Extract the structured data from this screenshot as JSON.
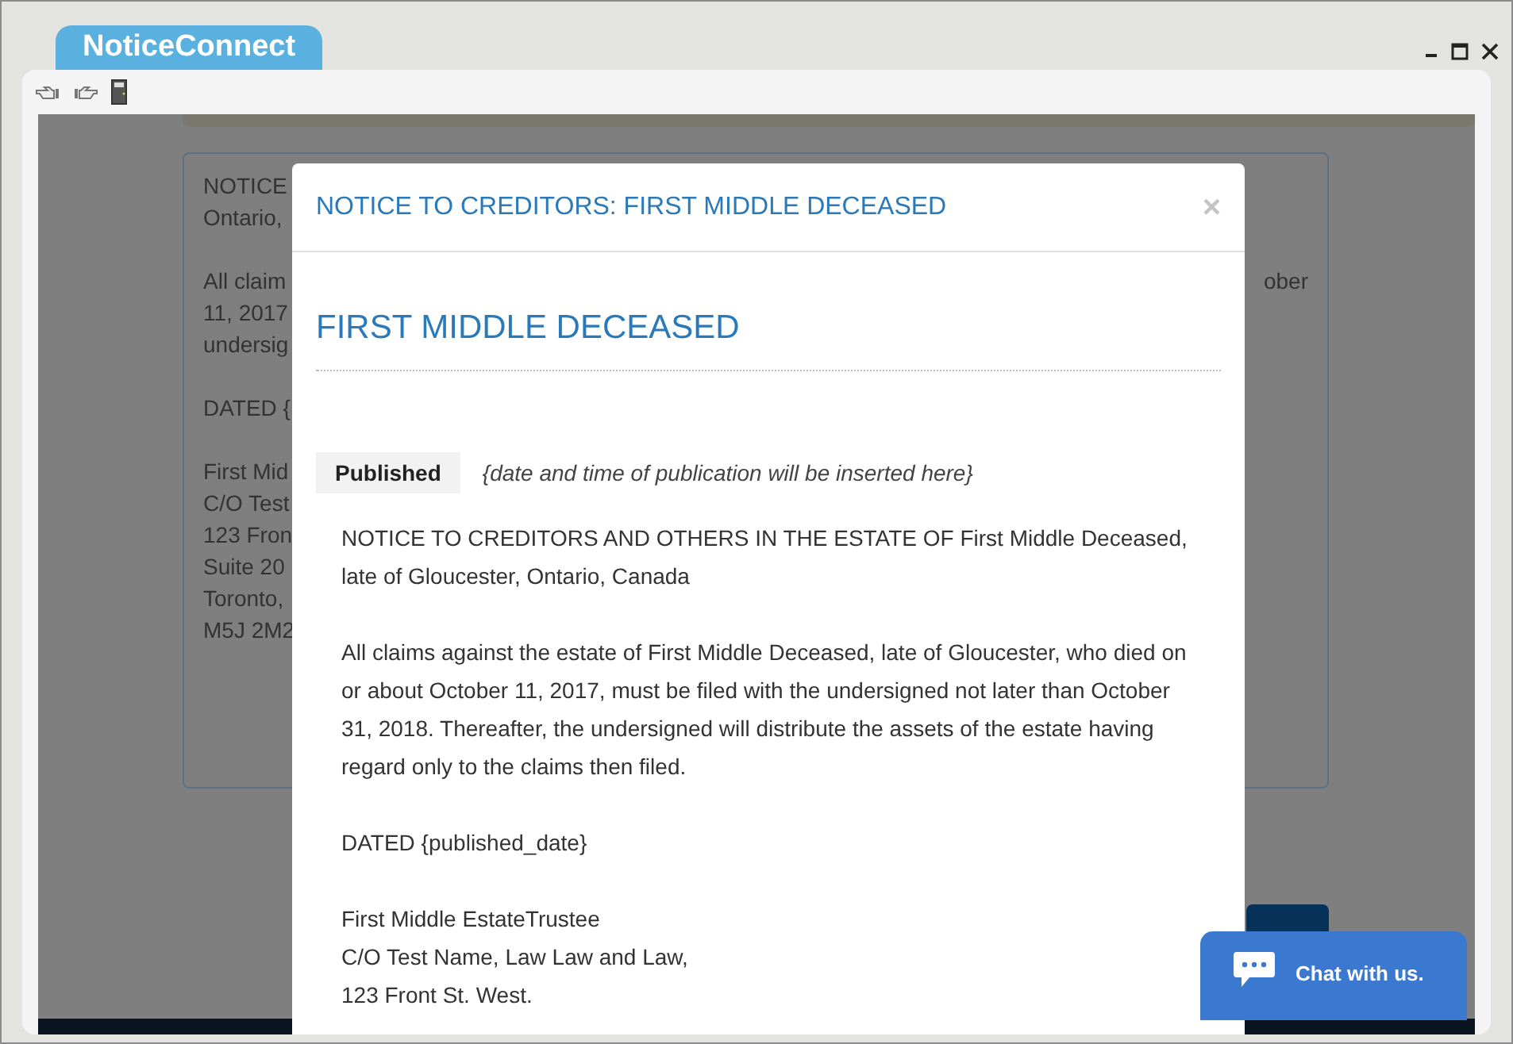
{
  "window": {
    "title": "NoticeConnect"
  },
  "background_notice": {
    "paragraphs": [
      [
        "NOTICE",
        "Ontario,"
      ],
      [
        "All claim",
        "11, 2017",
        "undersig"
      ],
      [
        "DATED {"
      ],
      [
        "First Mid",
        "C/O Test",
        "123 Fron",
        "Suite 20",
        "Toronto,",
        "M5J 2M2"
      ]
    ],
    "right_fragment": "ober"
  },
  "modal": {
    "title": "NOTICE TO CREDITORS: FIRST MIDDLE DECEASED",
    "close": "×",
    "heading": "FIRST MIDDLE DECEASED",
    "published_label": "Published",
    "published_note": "{date and time of publication will be inserted here}",
    "paragraphs": [
      [
        "NOTICE TO CREDITORS AND OTHERS IN THE ESTATE OF First Middle Deceased, late of Gloucester, Ontario, Canada"
      ],
      [
        "All claims against the estate of First Middle Deceased, late of Gloucester, who died on or about October 11, 2017, must be filed with the undersigned not later than October 31, 2018. Thereafter, the undersigned will distribute the assets of the estate having regard only to the claims then filed."
      ],
      [
        "DATED {published_date}"
      ],
      [
        "First Middle EstateTrustee",
        "C/O Test Name, Law Law and Law,",
        "123 Front St. West."
      ]
    ]
  },
  "chat": {
    "label": "Chat with us."
  }
}
